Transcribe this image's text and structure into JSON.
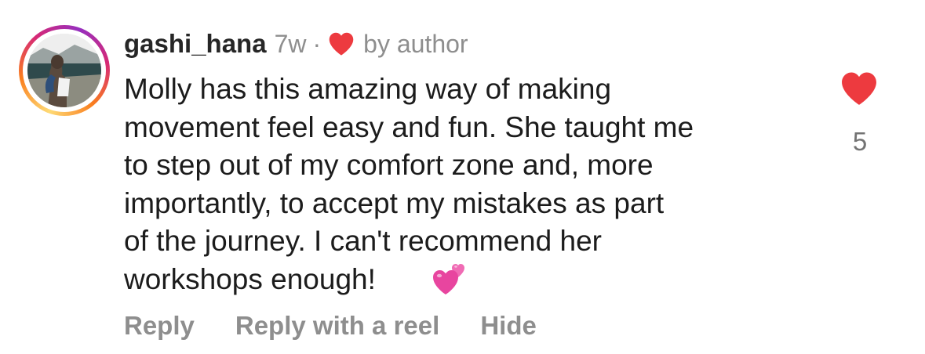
{
  "comment": {
    "username": "gashi_hana",
    "time": "7w",
    "separator": "·",
    "liked_by_author_text": "by author",
    "text": "Molly has this amazing way of making\nmovement feel easy and fun. She taught me\nto step out of my comfort zone and, more\nimportantly, to accept my mistakes as part\nof the journey. I can't recommend her\nworkshops enough!",
    "emoji": "two-hearts-emoji",
    "like_count": "5"
  },
  "actions": {
    "reply": "Reply",
    "reply_with_reel": "Reply with a reel",
    "hide": "Hide"
  },
  "icons": {
    "author_heart": "heart-icon",
    "like": "heart-icon",
    "avatar": "profile-photo"
  },
  "colors": {
    "heart_red": "#ed3a3f",
    "username": "#262626",
    "secondary_text": "#8e8e8e",
    "emoji_pink": "#e8459f"
  }
}
